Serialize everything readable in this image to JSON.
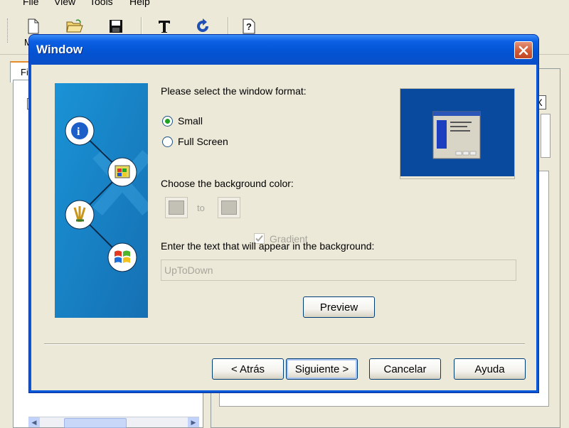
{
  "menubar": {
    "items": [
      "File",
      "View",
      "Tools",
      "Help"
    ]
  },
  "toolbar": {
    "caption": "M",
    "buttons": [
      {
        "icon": "new-file-icon"
      },
      {
        "icon": "open-folder-icon"
      },
      {
        "icon": "save-disk-icon"
      },
      {
        "icon": "text-T-icon"
      },
      {
        "icon": "refresh-icon"
      },
      {
        "icon": "help-icon"
      }
    ]
  },
  "background": {
    "tab_label": "Fi",
    "close_glyph": "X"
  },
  "dialog": {
    "title": "Window",
    "format_label": "Please select the window format:",
    "radio_small": "Small",
    "radio_fullscreen": "Full Screen",
    "selected_format": "Small",
    "bgcolor_label": "Choose the background color:",
    "to_label": "to",
    "gradient_label": "Gradient",
    "gradient_checked": true,
    "text_label": "Enter the text that will appear in the background:",
    "text_value": "UpToDown",
    "preview_button": "Preview",
    "back_button": "< Atrás",
    "next_button": "Siguiente >",
    "cancel_button": "Cancelar",
    "help_button": "Ayuda"
  },
  "colors": {
    "title_bar": "#0a58d6",
    "dialog_bg": "#ece9d8",
    "side_image": "#1f84c9",
    "preview_blue": "#0a4a9e",
    "close_red": "#d05a35"
  }
}
